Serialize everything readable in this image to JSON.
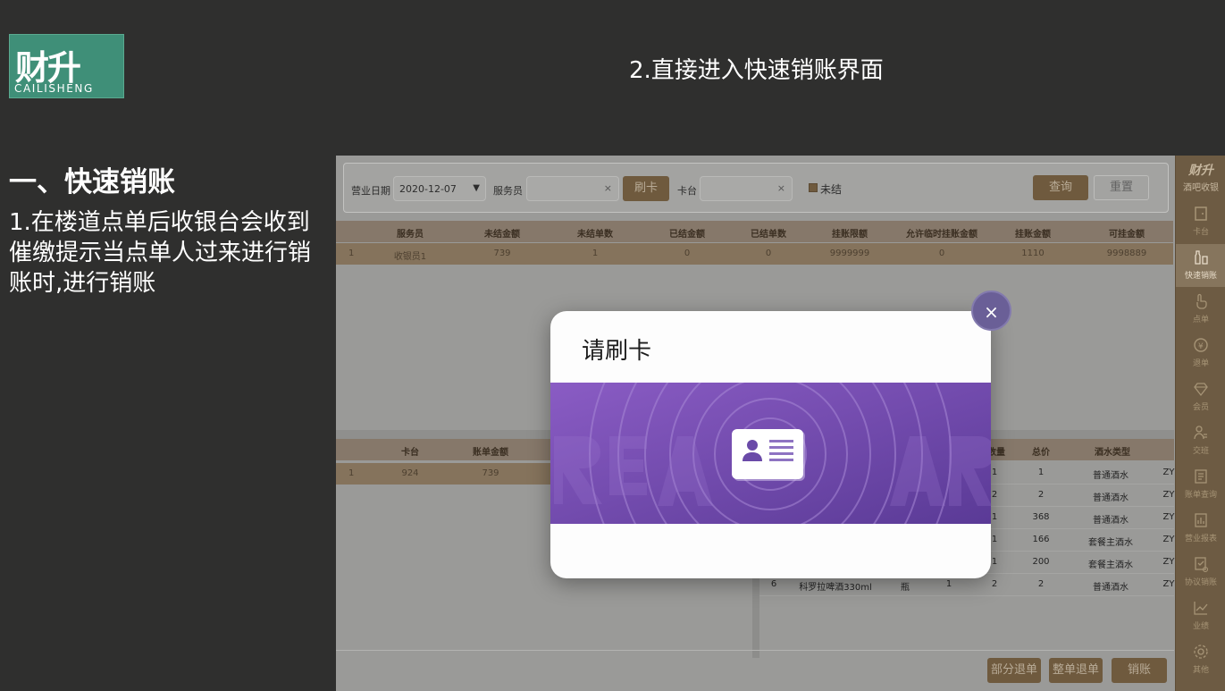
{
  "logo": {
    "main": "财升",
    "sub": "CAILISHENG"
  },
  "step_title": "2.直接进入快速销账界面",
  "section": {
    "title": "一、快速销账",
    "desc": "1.在楼道点单后收银台会收到催缴提示当点单人过来进行销账时,进行销账"
  },
  "filter": {
    "date_label": "营业日期",
    "date_value": "2020-12-07",
    "waiter_label": "服务员",
    "swipe_button": "刷卡",
    "table_label": "卡台",
    "unsettled_label": "未结",
    "query_button": "查询",
    "reset_button": "重置"
  },
  "top_table": {
    "headers": [
      "服务员",
      "未结金额",
      "未结单数",
      "已结金额",
      "已结单数",
      "挂账限额",
      "允许临时挂账金额",
      "挂账金额",
      "可挂金额"
    ],
    "rows": [
      {
        "idx": "1",
        "cells": [
          "收银员1",
          "739",
          "1",
          "0",
          "0",
          "9999999",
          "0",
          "1110",
          "9998889"
        ]
      }
    ]
  },
  "left_table": {
    "headers": [
      "卡台",
      "账单金额"
    ],
    "rows": [
      {
        "idx": "1",
        "cells": [
          "924",
          "739"
        ]
      }
    ]
  },
  "right_table": {
    "headers": [
      "数量",
      "总价",
      "酒水类型"
    ],
    "rows": [
      {
        "qty": "1",
        "total": "1",
        "type": "普通酒水",
        "extra": "ZY"
      },
      {
        "qty": "2",
        "total": "2",
        "type": "普通酒水",
        "extra": "ZY"
      },
      {
        "qty": "1",
        "total": "368",
        "type": "普通酒水",
        "extra": "ZY"
      },
      {
        "qty": "1",
        "total": "166",
        "type": "套餐主酒水",
        "extra": "ZY"
      },
      {
        "qty": "1",
        "total": "200",
        "type": "套餐主酒水",
        "extra": "ZY"
      },
      {
        "idx": "6",
        "name": "科罗拉啤酒330ml",
        "unit": "瓶",
        "n": "1",
        "qty": "2",
        "total": "2",
        "type": "普通酒水",
        "extra": "ZY"
      }
    ]
  },
  "bottom_buttons": {
    "partial_refund": "部分退单",
    "full_refund": "整单退单",
    "settle": "销账"
  },
  "sidebar": {
    "brand_top": "财升",
    "brand_sub": "酒吧收银",
    "items": [
      {
        "label": "卡台",
        "icon": "door-icon"
      },
      {
        "label": "快速销账",
        "icon": "bottles-icon"
      },
      {
        "label": "点单",
        "icon": "hand-pointer-icon"
      },
      {
        "label": "退单",
        "icon": "refund-icon"
      },
      {
        "label": "会员",
        "icon": "diamond-icon"
      },
      {
        "label": "交班",
        "icon": "users-icon"
      },
      {
        "label": "账单查询",
        "icon": "bill-icon"
      },
      {
        "label": "营业报表",
        "icon": "report-icon"
      },
      {
        "label": "协议销账",
        "icon": "agreement-icon"
      },
      {
        "label": "业绩",
        "icon": "chart-line-icon"
      },
      {
        "label": "其他",
        "icon": "gear-icon"
      }
    ]
  },
  "modal": {
    "title": "请刷卡",
    "close": "×"
  },
  "colors": {
    "accent_brown": "#6f5a3e",
    "sidebar": "#6d5b43",
    "modal_purple": "#6e47a6",
    "logo_green": "#3f8f78"
  }
}
